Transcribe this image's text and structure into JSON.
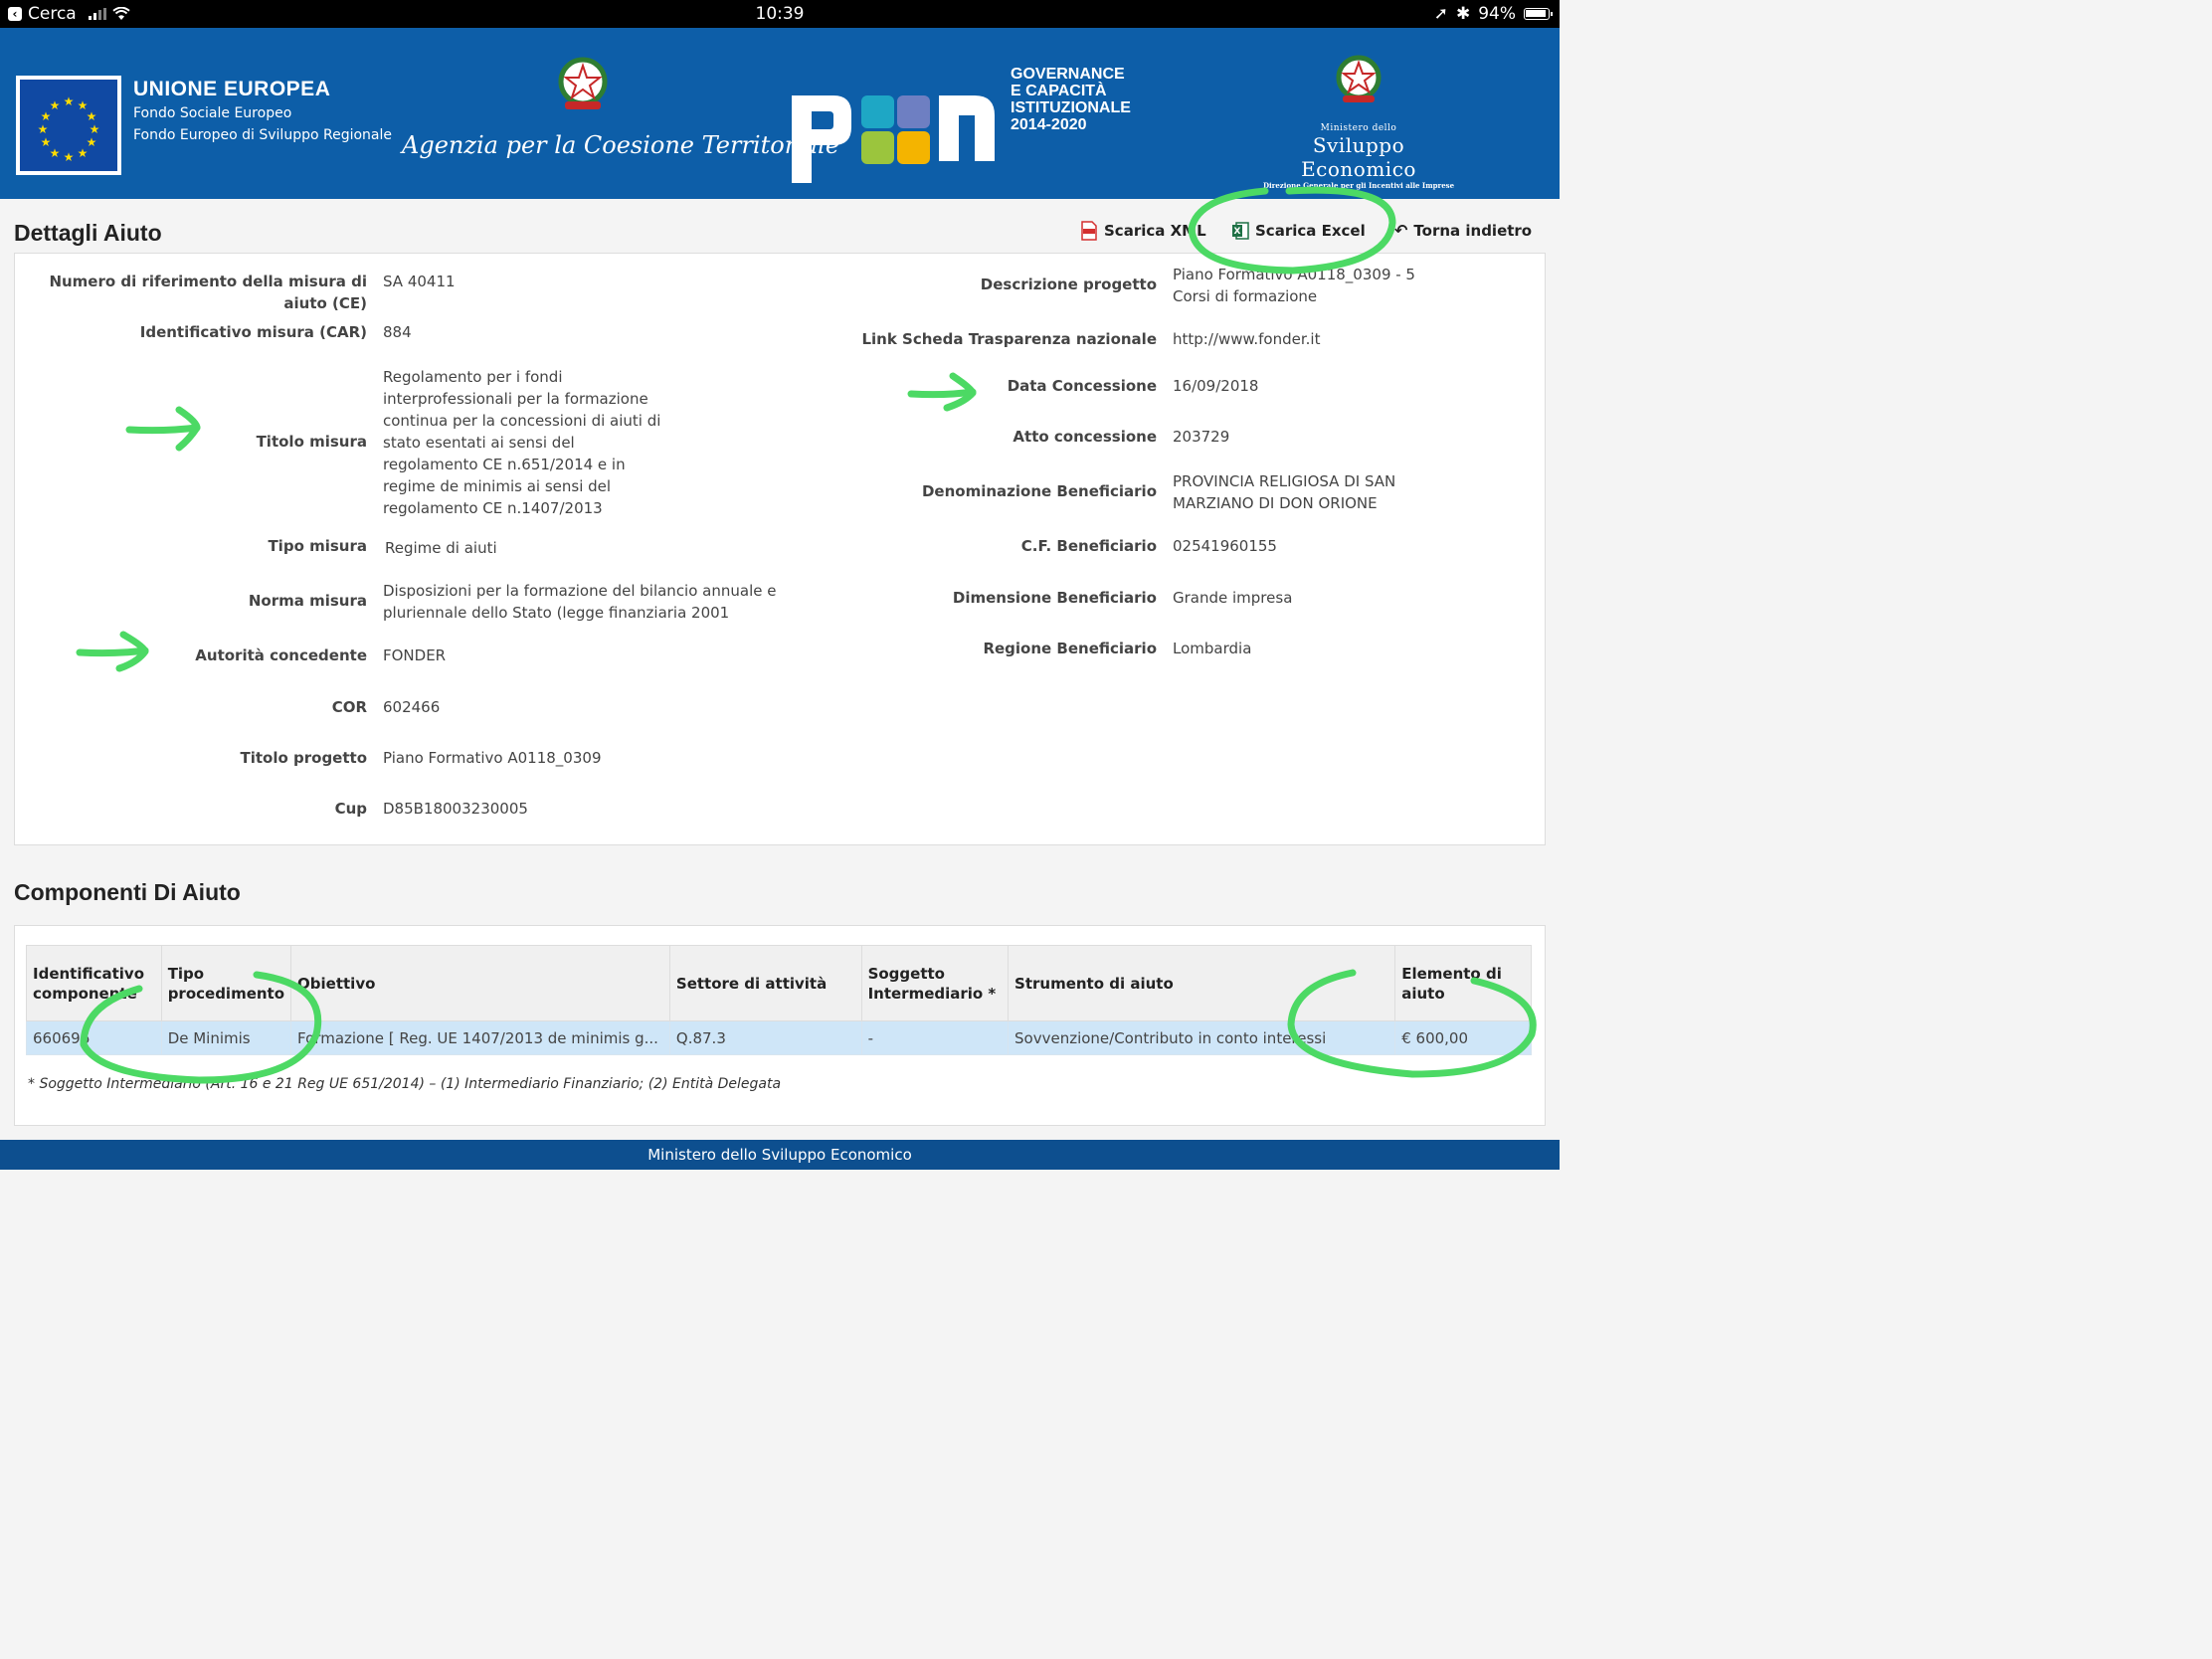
{
  "status_bar": {
    "back_label": "Cerca",
    "time": "10:39",
    "battery": "94%"
  },
  "header": {
    "eu_title": "UNIONE EUROPEA",
    "eu_line1": "Fondo Sociale Europeo",
    "eu_line2": "Fondo Europeo di Sviluppo Regionale",
    "agenzia": "Agenzia per la Coesione Territoriale",
    "pon_word": "PON",
    "pon_line1": "GOVERNANCE",
    "pon_line2": "E CAPACITÀ",
    "pon_line3": "ISTITUZIONALE",
    "pon_line4": "2014-2020",
    "mise_small": "Ministero dello",
    "mise_title": "Sviluppo Economico",
    "mise_sub": "Direzione Generale per gli Incentivi alle Imprese",
    "emblem_text": "REPUBBLICA ITALIANA"
  },
  "actions": {
    "xml": "Scarica XML",
    "excel": "Scarica Excel",
    "back": "Torna indietro"
  },
  "details": {
    "title": "Dettagli Aiuto",
    "left": [
      {
        "label": "Numero di riferimento della misura di aiuto (CE)",
        "value": "SA 40411"
      },
      {
        "label": "Identificativo misura (CAR)",
        "value": "884"
      },
      {
        "label": "Titolo misura",
        "value": "Regolamento per i fondi interprofessionali per la formazione continua per la concessioni di aiuti di stato esentati ai sensi del regolamento CE n.651/2014 e in regime de minimis ai sensi del regolamento CE n.1407/2013"
      },
      {
        "label": "Tipo misura",
        "value": "Regime di aiuti"
      },
      {
        "label": "Norma misura",
        "value": "Disposizioni per la formazione del bilancio annuale e pluriennale dello Stato (legge finanziaria 2001"
      },
      {
        "label": "Autorità concedente",
        "value": "FONDER"
      },
      {
        "label": "COR",
        "value": "602466"
      },
      {
        "label": "Titolo progetto",
        "value": "Piano Formativo A0118_0309"
      },
      {
        "label": "Cup",
        "value": "D85B18003230005"
      }
    ],
    "right": [
      {
        "label": "Descrizione progetto",
        "value": "Piano Formativo A0118_0309 - 5 Corsi di formazione"
      },
      {
        "label": "Link Scheda Trasparenza nazionale",
        "value": "http://www.fonder.it"
      },
      {
        "label": "Data Concessione",
        "value": "16/09/2018"
      },
      {
        "label": "Atto concessione",
        "value": "203729"
      },
      {
        "label": "Denominazione Beneficiario",
        "value": "PROVINCIA RELIGIOSA DI SAN MARZIANO DI DON ORIONE"
      },
      {
        "label": "C.F. Beneficiario",
        "value": "02541960155"
      },
      {
        "label": "Dimensione Beneficiario",
        "value": "Grande impresa"
      },
      {
        "label": "Regione Beneficiario",
        "value": "Lombardia"
      }
    ]
  },
  "components": {
    "title": "Componenti Di Aiuto",
    "headers": [
      "Identificativo componente",
      "Tipo procedimento",
      "Obiettivo",
      "Settore di attività",
      "Soggetto Intermediario *",
      "Strumento di aiuto",
      "Elemento di aiuto"
    ],
    "rows": [
      [
        "660696",
        "De Minimis",
        "Formazione [ Reg. UE 1407/2013 de minimis g...",
        "Q.87.3",
        "-",
        "Sovvenzione/Contributo in conto interessi",
        "€ 600,00"
      ]
    ],
    "footnote": "* Soggetto Intermediario (Art. 16 e 21 Reg UE 651/2014) – (1) Intermediario Finanziario; (2) Entità Delegata"
  },
  "footer": "Ministero dello Sviluppo Economico",
  "colors": {
    "banner": "#0d5ea8",
    "footer": "#0d4f8f",
    "highlight_row": "#cfe6f8",
    "annotation": "#4cd964"
  }
}
